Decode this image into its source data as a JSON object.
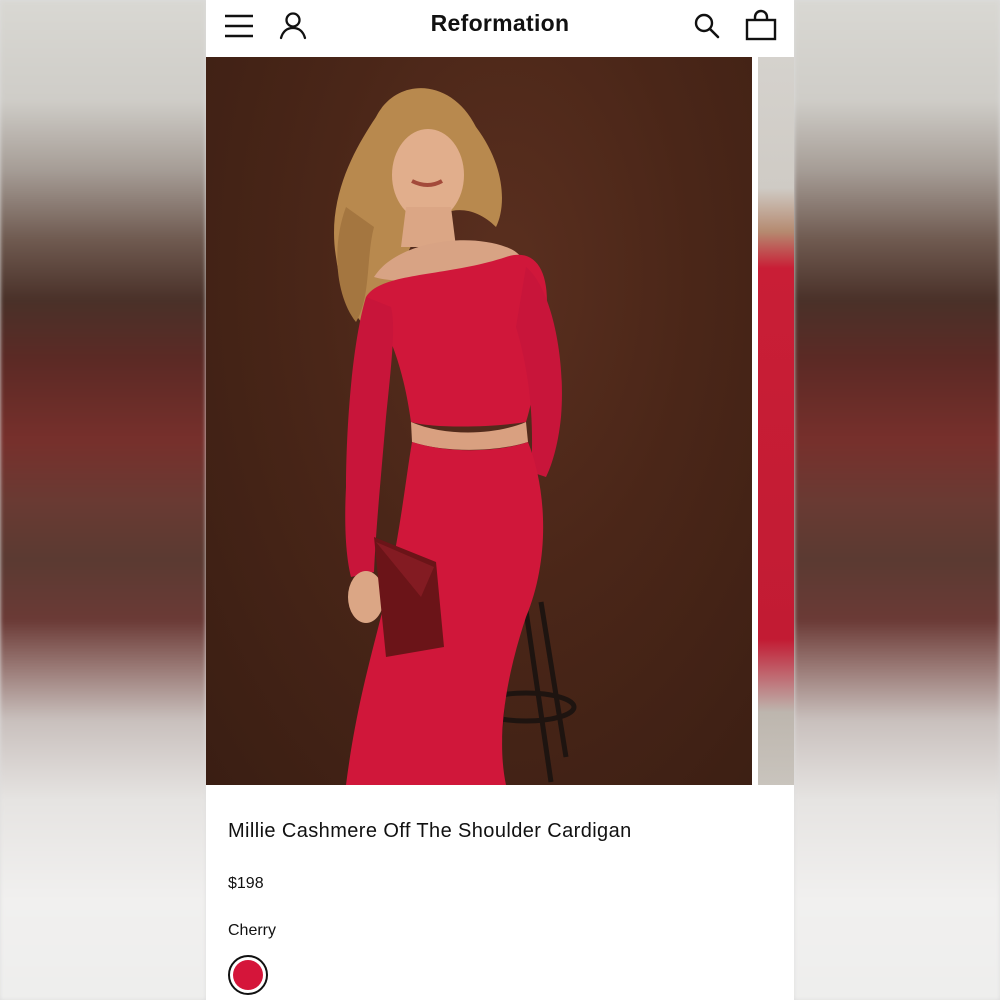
{
  "header": {
    "brand": "Reformation",
    "icons": [
      "menu-icon",
      "account-icon",
      "search-icon",
      "bag-icon"
    ]
  },
  "product": {
    "name": "Millie Cashmere Off The Shoulder Cardigan",
    "price": "$198",
    "color_name": "Cherry",
    "swatch_color": "#d5153a"
  },
  "colors": {
    "photo_background": "#4a2618",
    "garment": "#d0173a",
    "clutch": "#6b1418"
  }
}
